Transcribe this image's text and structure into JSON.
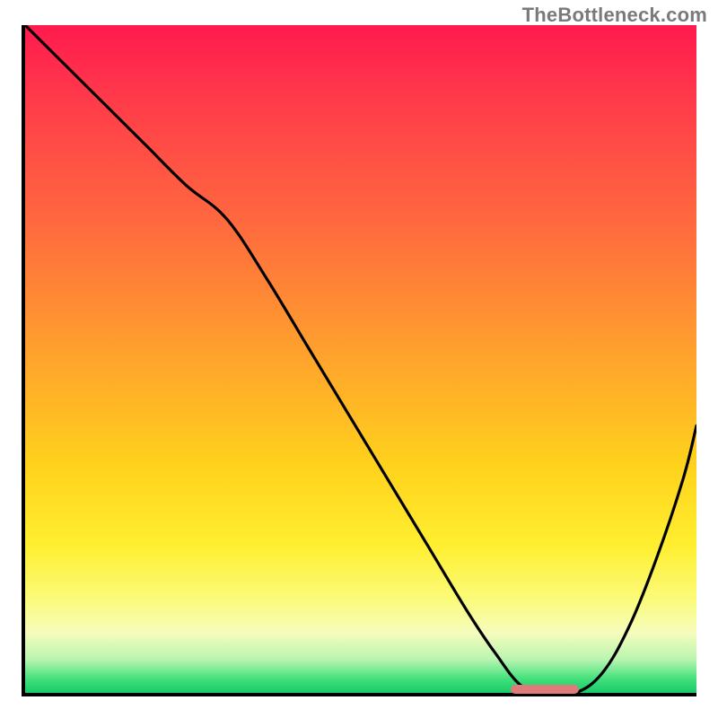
{
  "watermark": "TheBottleneck.com",
  "colors": {
    "border": "#000000",
    "curve": "#000000",
    "marker": "#e07b7b",
    "watermark_text": "#7a7a7a"
  },
  "chart_data": {
    "type": "line",
    "title": "",
    "xlabel": "",
    "ylabel": "",
    "xlim": [
      0,
      100
    ],
    "ylim": [
      0,
      100
    ],
    "grid": false,
    "series": [
      {
        "name": "curve",
        "x": [
          0,
          6,
          12,
          18,
          24,
          30,
          36,
          42,
          48,
          54,
          60,
          66,
          70,
          74,
          78,
          82,
          86,
          90,
          94,
          98,
          100
        ],
        "y": [
          100,
          94,
          88,
          82,
          76,
          71,
          62,
          52,
          42,
          32,
          22,
          12,
          6,
          1,
          0,
          0,
          3,
          10,
          20,
          32,
          40
        ]
      }
    ],
    "marker": {
      "x_start": 72,
      "x_end": 82,
      "y": 0.5
    },
    "background_gradient_stops": [
      {
        "pos": 0,
        "color": "#ff1a4e"
      },
      {
        "pos": 12,
        "color": "#ff3d4a"
      },
      {
        "pos": 30,
        "color": "#ff6a3e"
      },
      {
        "pos": 48,
        "color": "#ff9e2e"
      },
      {
        "pos": 66,
        "color": "#ffd21c"
      },
      {
        "pos": 78,
        "color": "#ffef30"
      },
      {
        "pos": 86,
        "color": "#fbfb7a"
      },
      {
        "pos": 91,
        "color": "#f6fcbd"
      },
      {
        "pos": 95,
        "color": "#b9f5b0"
      },
      {
        "pos": 98,
        "color": "#3fe07a"
      },
      {
        "pos": 100,
        "color": "#18c96a"
      }
    ]
  }
}
